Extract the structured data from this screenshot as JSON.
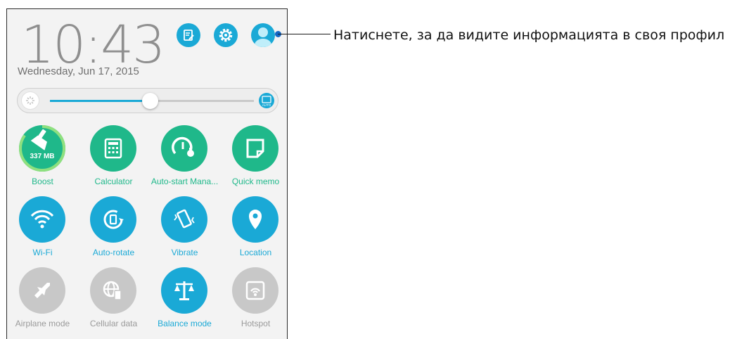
{
  "status": {
    "time": "10:43",
    "date": "Wednesday, Jun 17, 2015"
  },
  "header_icons": {
    "edit": "edit-icon",
    "settings": "gear-icon",
    "profile": "profile-avatar-icon"
  },
  "brightness": {
    "level_percent": 49,
    "auto_label": "AUTO"
  },
  "tiles": [
    {
      "label": "Boost",
      "value": "337 MB",
      "icon": "broom-icon",
      "state": "green",
      "usage_fraction": 0.85
    },
    {
      "label": "Calculator",
      "icon": "calculator-icon",
      "state": "green"
    },
    {
      "label": "Auto-start Mana...",
      "icon": "gauge-wrench-icon",
      "state": "green"
    },
    {
      "label": "Quick memo",
      "icon": "memo-icon",
      "state": "green"
    },
    {
      "label": "Wi-Fi",
      "icon": "wifi-icon",
      "state": "blue"
    },
    {
      "label": "Auto-rotate",
      "icon": "rotate-icon",
      "state": "blue"
    },
    {
      "label": "Vibrate",
      "icon": "vibrate-icon",
      "state": "blue"
    },
    {
      "label": "Location",
      "icon": "location-pin-icon",
      "state": "blue"
    },
    {
      "label": "Airplane mode",
      "icon": "airplane-icon",
      "state": "grey"
    },
    {
      "label": "Cellular data",
      "icon": "globe-phone-icon",
      "state": "grey"
    },
    {
      "label": "Balance mode",
      "icon": "balance-scale-icon",
      "state": "blue"
    },
    {
      "label": "Hotspot",
      "icon": "hotspot-icon",
      "state": "grey"
    }
  ],
  "callout": {
    "text": "Натиснете, за да видите информацията в своя профил"
  },
  "colors": {
    "green": "#1fb88a",
    "blue": "#1aa9d6",
    "grey": "#c8c8c8",
    "callout_dot": "#1467c4"
  }
}
